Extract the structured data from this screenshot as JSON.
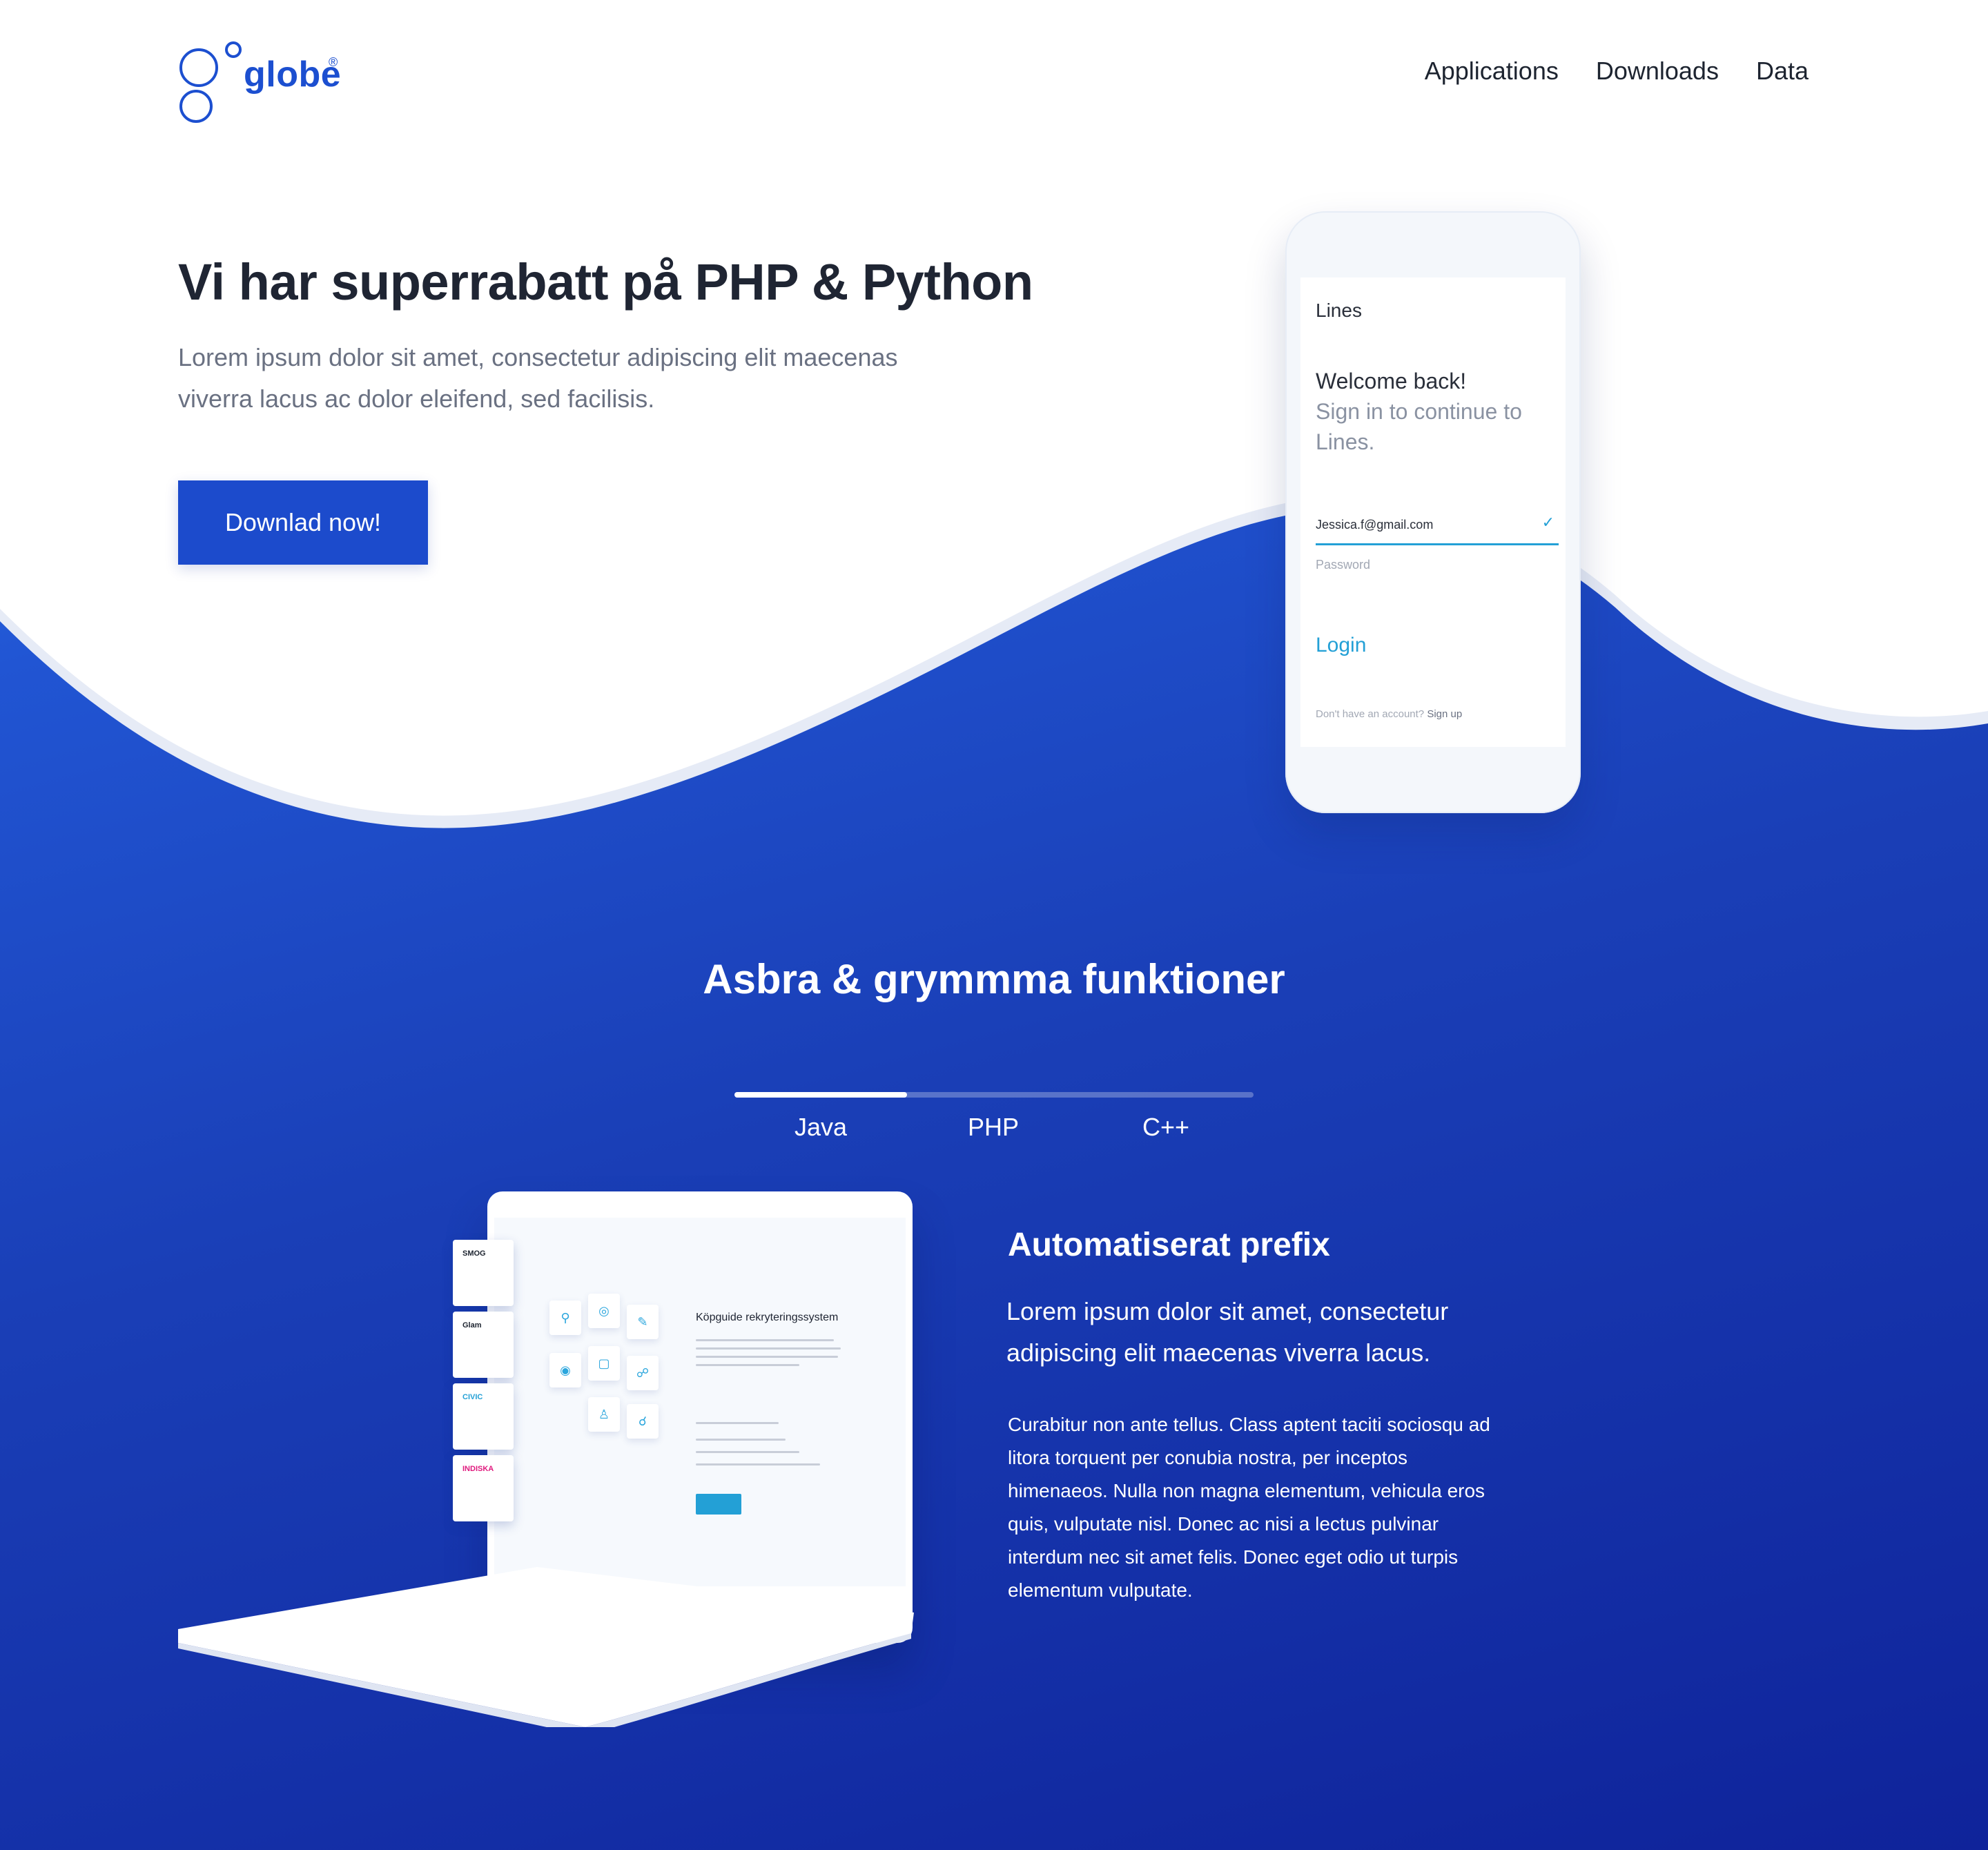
{
  "header": {
    "logo_text": "globe",
    "logo_reg": "®",
    "nav": [
      "Applications",
      "Downloads",
      "Data"
    ]
  },
  "hero": {
    "title": "Vi har superrabatt på PHP & Python",
    "description": "Lorem ipsum dolor sit amet, consectetur adipiscing elit maecenas viverra lacus ac dolor eleifend, sed facilisis.",
    "cta": "Downlad now!"
  },
  "phone": {
    "app_name": "Lines",
    "welcome": "Welcome back!",
    "subtitle": "Sign in to continue to Lines.",
    "email": "Jessica.f@gmail.com",
    "password_placeholder": "Password",
    "login": "Login",
    "footer_text": "Don't have an account?",
    "footer_link": "Sign up"
  },
  "features": {
    "title": "Asbra & grymmma funktioner",
    "tabs": [
      "Java",
      "PHP",
      "C++"
    ],
    "active_tab_progress": 0.333,
    "feature_title": "Automatiserat prefix",
    "lead": "Lorem ipsum dolor sit amet, consectetur adipiscing elit maecenas viverra lacus.",
    "body": "Curabitur non ante tellus. Class aptent taciti sociosqu ad litora torquent per conubia nostra, per inceptos himenaeos. Nulla non magna elementum, vehicula eros quis, vulputate nisl. Donec ac nisi a lectus pulvinar interdum nec sit amet felis. Donec eget odio ut turpis elementum vulputate."
  },
  "laptop_screen": {
    "heading": "Köpguide rekryteringssystem",
    "cards": [
      "SMOG",
      "Glam",
      "CIVIC",
      "INDISKA"
    ]
  },
  "colors": {
    "brand": "#1c4fd0",
    "cta": "#1c4bcc",
    "accent": "#23a0d6",
    "gradient_light": "#2f86ff",
    "gradient_dark": "#0f239a"
  }
}
